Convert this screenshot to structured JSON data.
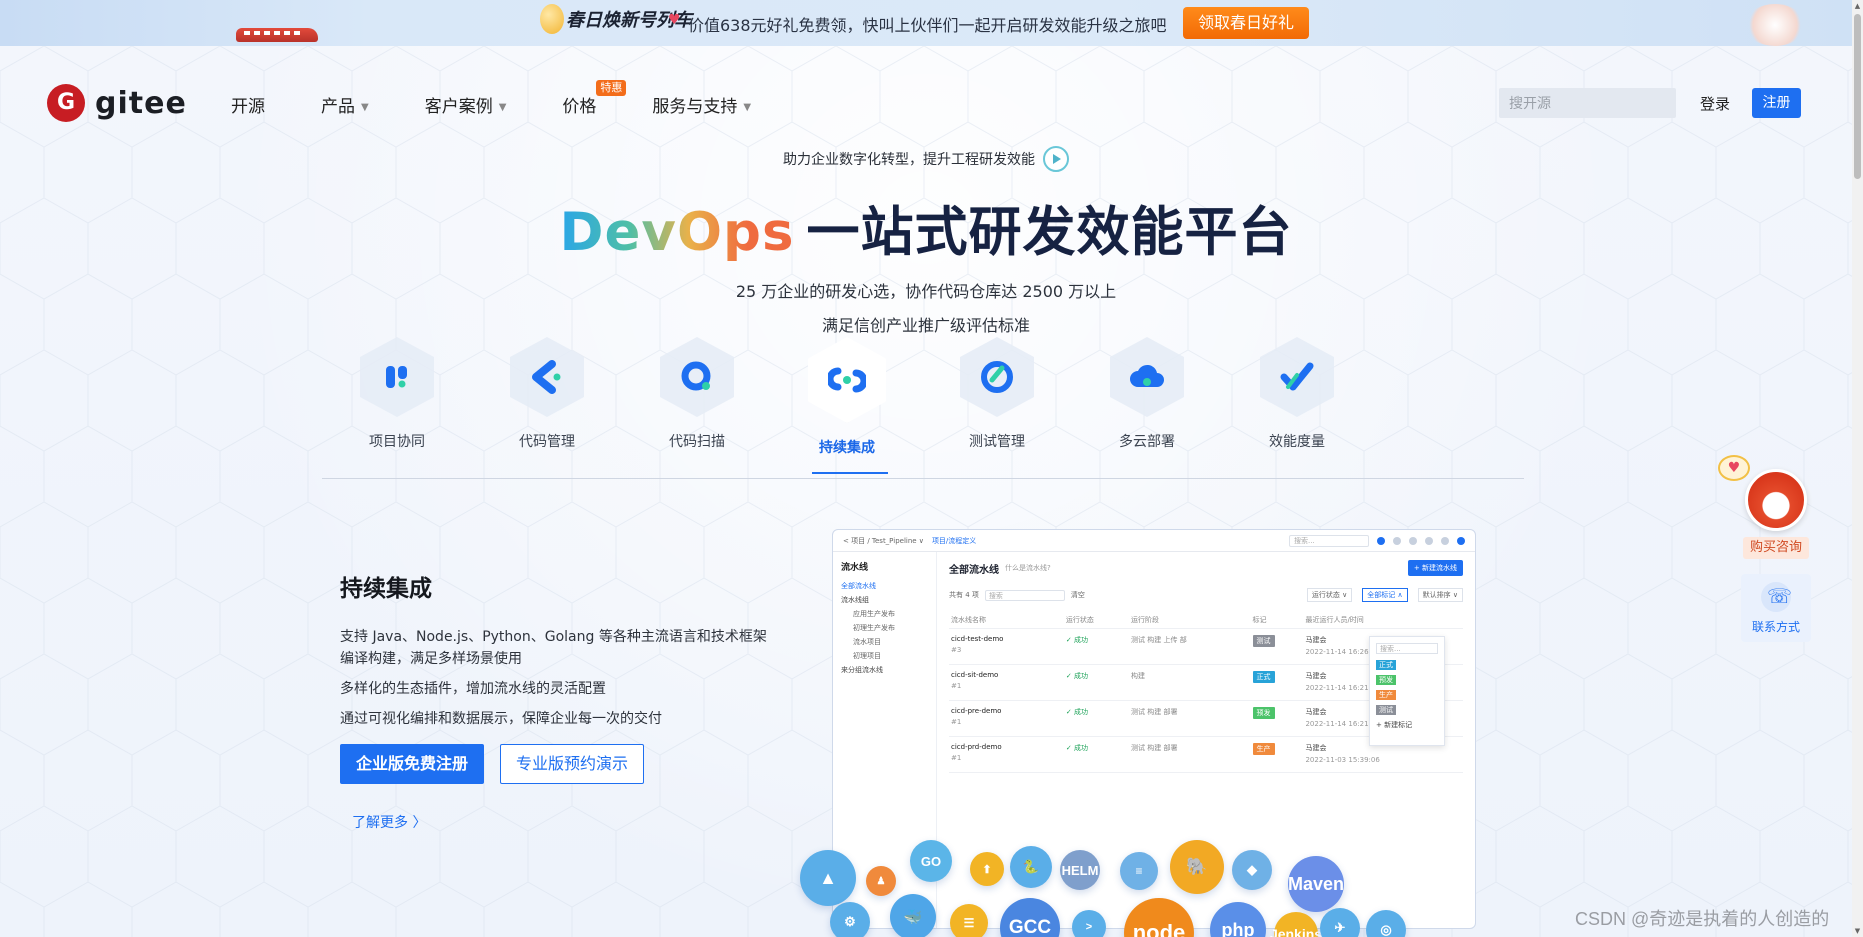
{
  "banner": {
    "brand": "春日焕新号列车",
    "message": "价值638元好礼免费领，快叫上伙伴们一起开启研发效能升级之旅吧",
    "cta": "领取春日好礼"
  },
  "header": {
    "logo_mark": "G",
    "logo_text": "gitee",
    "nav": [
      {
        "label": "开源"
      },
      {
        "label": "产品"
      },
      {
        "label": "客户案例"
      },
      {
        "label": "价格",
        "badge": "特惠"
      },
      {
        "label": "服务与支持"
      }
    ],
    "search_placeholder": "搜开源",
    "login": "登录",
    "signup": "注册"
  },
  "hero": {
    "subtitle": "助力企业数字化转型，提升工程研发效能",
    "title_devops": "DevOps",
    "title_rest": "一站式研发效能平台",
    "desc1": "25 万企业的研发心选，协作代码仓库达 2500 万以上",
    "desc2": "满足信创产业推广级评估标准"
  },
  "tabs": [
    {
      "label": "项目协同",
      "icon": "project-icon",
      "color": "#1e6ff1"
    },
    {
      "label": "代码管理",
      "icon": "code-icon",
      "color": "#1e6ff1"
    },
    {
      "label": "代码扫描",
      "icon": "scan-icon",
      "color": "#1e6ff1"
    },
    {
      "label": "持续集成",
      "icon": "ci-icon",
      "color": "#1e6ff1",
      "active": true
    },
    {
      "label": "测试管理",
      "icon": "test-icon",
      "color": "#1e6ff1"
    },
    {
      "label": "多云部署",
      "icon": "cloud-icon",
      "color": "#1e6ff1"
    },
    {
      "label": "效能度量",
      "icon": "metrics-icon",
      "color": "#1e6ff1"
    }
  ],
  "feature": {
    "title": "持续集成",
    "line1": "支持 Java、Node.js、Python、Golang 等各种主流语言和技术框架",
    "line2": "编译构建，满足多样场景使用",
    "line3": "多样化的生态插件，增加流水线的灵活配置",
    "line4": "通过可视化编排和数据展示，保障企业每一次的交付",
    "btn_primary": "企业版免费注册",
    "btn_outline": "专业版预约演示",
    "more": "了解更多 〉"
  },
  "mock": {
    "crumb1": "< 项目 / Test_Pipeline ∨",
    "crumb2": "项目/流程定义",
    "search": "搜索...",
    "side_title": "流水线",
    "side_items": [
      "全部流水线",
      "流水线组",
      "应用生产发布",
      "初理生产发布",
      "流水项目",
      "初理项目",
      "来分组流水线"
    ],
    "main_title": "全部流水线",
    "main_q": "什么是流水线?",
    "new_btn": "+ 新建流水线",
    "count": "共有 4 项",
    "filter_search": "搜索",
    "filter_clear": "清空",
    "filters": [
      "运行状态 ∨",
      "全部标记 ∧",
      "默认排序 ∨"
    ],
    "columns": [
      "流水线名称",
      "运行状态",
      "运行阶段",
      "标记",
      "最近运行人员/时间"
    ],
    "rows": [
      {
        "name": "cicd-test-demo",
        "id": "#3",
        "status": "✓ 成功",
        "stages": "测试  构建  上传  部",
        "tag": "测试",
        "tag_color": "#8b8f98",
        "user": "马建会",
        "time": "2022-11-14 16:26:09"
      },
      {
        "name": "cicd-sit-demo",
        "id": "#1",
        "status": "✓ 成功",
        "stages": "构建",
        "tag": "正式",
        "tag_color": "#28a3d8",
        "user": "马建会",
        "time": "2022-11-14 16:21:50"
      },
      {
        "name": "cicd-pre-demo",
        "id": "#1",
        "status": "✓ 成功",
        "stages": "测试  构建  部署",
        "tag": "预发",
        "tag_color": "#4cc36a",
        "user": "马建会",
        "time": "2022-11-14 16:21:21"
      },
      {
        "name": "cicd-prd-demo",
        "id": "#1",
        "status": "✓ 成功",
        "stages": "测试  构建  部署",
        "tag": "生产",
        "tag_color": "#f08a3c",
        "user": "马建会",
        "time": "2022-11-03 15:39:06"
      }
    ],
    "dropdown_search": "搜索...",
    "dropdown_opts": [
      {
        "label": "正式",
        "color": "#28a3d8"
      },
      {
        "label": "预发",
        "color": "#4cc36a"
      },
      {
        "label": "生产",
        "color": "#f08a3c"
      },
      {
        "label": "测试",
        "color": "#8b8f98"
      }
    ],
    "dropdown_add": "+ 新建标记"
  },
  "bubbles": [
    {
      "label": "▲",
      "icon": "mountain-icon",
      "color": "#5aaee8"
    },
    {
      "label": "♟",
      "icon": "jenkins-figure-icon",
      "color": "#f08a3c"
    },
    {
      "label": "GO",
      "icon": "go-icon",
      "color": "#5bb5e8"
    },
    {
      "label": "⬆",
      "icon": "upload-icon",
      "color": "#f2b425"
    },
    {
      "label": "🐍",
      "icon": "python-icon",
      "color": "#5aaee8"
    },
    {
      "label": "HELM",
      "icon": "helm-icon",
      "color": "#7f9fcc"
    },
    {
      "label": "≡",
      "icon": "scroll-icon",
      "color": "#6fb1e6"
    },
    {
      "label": "🐘",
      "icon": "elephant-icon",
      "color": "#f2a924"
    },
    {
      "label": "◆",
      "icon": "leaf-icon",
      "color": "#6fb1e6"
    },
    {
      "label": "Maven",
      "icon": "maven-icon",
      "color": "#6b8fe8"
    },
    {
      "label": "⚙",
      "icon": "k8s-icon",
      "color": "#5aaee8"
    },
    {
      "label": "🐳",
      "icon": "docker-icon",
      "color": "#4fa6e8"
    },
    {
      "label": "☰",
      "icon": "db-icon",
      "color": "#f2b425"
    },
    {
      "label": "GCC",
      "icon": "gcc-icon",
      "color": "#4a86e0"
    },
    {
      "label": ">",
      "icon": "terminal-icon",
      "color": "#5aaee8"
    },
    {
      "label": "node",
      "icon": "node-icon",
      "color": "#f08a1c"
    },
    {
      "label": "php",
      "icon": "php-icon",
      "color": "#5a8fe8"
    },
    {
      "label": "Jenkins",
      "icon": "jenkins-icon",
      "color": "#f2b425"
    },
    {
      "label": "✈",
      "icon": "telegram-icon",
      "color": "#5aaee8"
    },
    {
      "label": "◎",
      "icon": "camera-icon",
      "color": "#5aaee8"
    }
  ],
  "float": {
    "buy": "购买咨询",
    "contact": "联系方式"
  },
  "watermark": "CSDN @奇迹是执着的人创造的"
}
